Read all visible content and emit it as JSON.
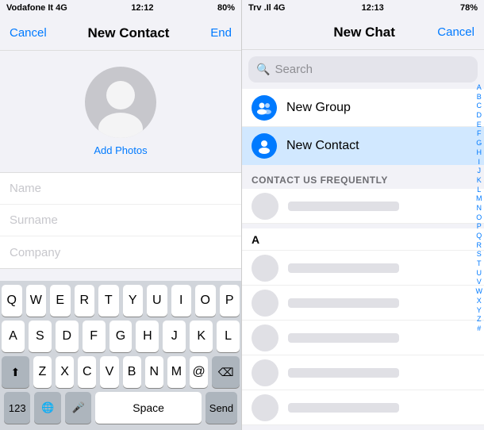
{
  "left": {
    "status_bar": {
      "carrier": "Vodafone It 4G",
      "time": "12:12",
      "battery": "80%"
    },
    "nav": {
      "cancel_label": "Cancel",
      "title": "New Contact",
      "end_label": "End"
    },
    "avatar": {
      "add_photos_label": "Add Photos"
    },
    "form": {
      "name_placeholder": "Name",
      "surname_placeholder": "Surname",
      "company_placeholder": "Company"
    },
    "keyboard": {
      "row1": [
        "Q",
        "W",
        "E",
        "R",
        "T",
        "Y",
        "U",
        "I",
        "O",
        "P"
      ],
      "row2": [
        "A",
        "S",
        "D",
        "F",
        "G",
        "H",
        "J",
        "K",
        "L"
      ],
      "row3": [
        "Z",
        "X",
        "C",
        "V",
        "B",
        "N",
        "M",
        "@"
      ],
      "num_label": "123",
      "space_label": "Space",
      "send_label": "Send"
    }
  },
  "right": {
    "status_bar": {
      "carrier": "Trv .Il 4G",
      "time": "12:13",
      "battery": "78%"
    },
    "nav": {
      "title": "New Chat",
      "cancel_label": "Cancel"
    },
    "search": {
      "placeholder": "Search"
    },
    "list_items": [
      {
        "id": "new-group",
        "label": "New Group"
      },
      {
        "id": "new-contact",
        "label": "New Contact"
      }
    ],
    "section_frequently": "CONTACT US FREQUENTLY",
    "section_a": "A",
    "alpha": [
      "A",
      "B",
      "C",
      "D",
      "E",
      "F",
      "G",
      "H",
      "I",
      "J",
      "K",
      "L",
      "M",
      "N",
      "O",
      "P",
      "Q",
      "R",
      "S",
      "T",
      "U",
      "V",
      "W",
      "X",
      "Y",
      "Z",
      "#"
    ]
  }
}
